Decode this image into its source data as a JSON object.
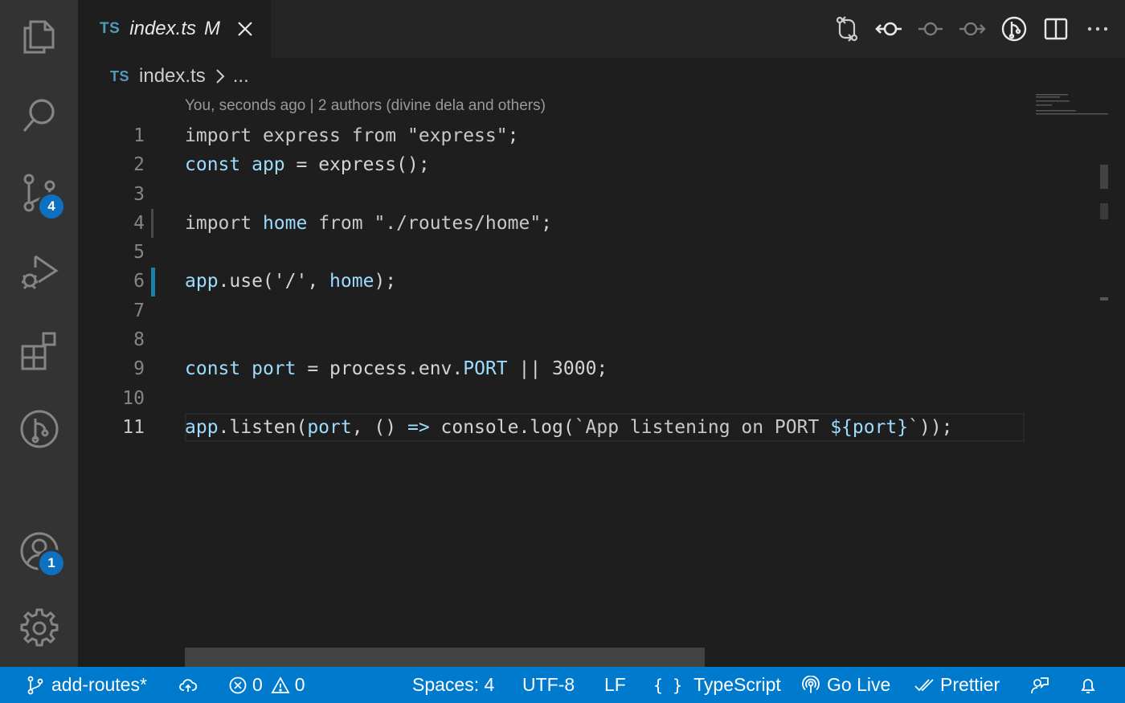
{
  "tab": {
    "lang_badge": "TS",
    "filename": "index.ts",
    "modified_flag": "M"
  },
  "breadcrumb": {
    "lang_badge": "TS",
    "file": "index.ts",
    "more": "..."
  },
  "codelens": "You, seconds ago | 2 authors (divine dela and others)",
  "line_numbers": [
    "1",
    "2",
    "3",
    "4",
    "5",
    "6",
    "7",
    "8",
    "9",
    "10",
    "11"
  ],
  "code": {
    "l1": {
      "a": "import",
      "b": " express ",
      "c": "from",
      "d": " ",
      "e": "\"express\"",
      "f": ";"
    },
    "l2": {
      "a": "const",
      "b": " ",
      "c": "app",
      "d": " = ",
      "e": "express",
      "f": "();"
    },
    "l4": {
      "a": "import",
      "b": " ",
      "c": "home",
      "d": " ",
      "e": "from",
      "f": " ",
      "g": "\"./routes/home\"",
      "h": ";"
    },
    "l6": {
      "a": "app",
      "b": ".use(",
      "c": "'/'",
      "d": ", ",
      "e": "home",
      "f": ");"
    },
    "l9": {
      "a": "const",
      "b": " ",
      "c": "port",
      "d": " = ",
      "e": "process",
      "f": ".",
      "g": "env",
      "h": ".",
      "i": "PORT",
      "j": " || ",
      "k": "3000",
      "l": ";"
    },
    "l11": {
      "a": "app",
      "b": ".listen(",
      "c": "port",
      "d": ", () ",
      "e": "=>",
      "f": " console.log(",
      "g": "`App listening on PORT ",
      "h": "${port}",
      "i": "`",
      "j": "));"
    }
  },
  "activity": {
    "scm_badge": "4",
    "accounts_badge": "1"
  },
  "status": {
    "branch": "add-routes*",
    "errors": "0",
    "warnings": "0",
    "spaces": "Spaces: 4",
    "encoding": "UTF-8",
    "eol": "LF",
    "language_braces": "{ }",
    "language": "TypeScript",
    "golive": "Go Live",
    "prettier": "Prettier"
  },
  "colors": {
    "status_bar": "#007acc",
    "activity_bar": "#333333",
    "editor_bg": "#1e1e1e",
    "badge": "#0e70c0"
  }
}
